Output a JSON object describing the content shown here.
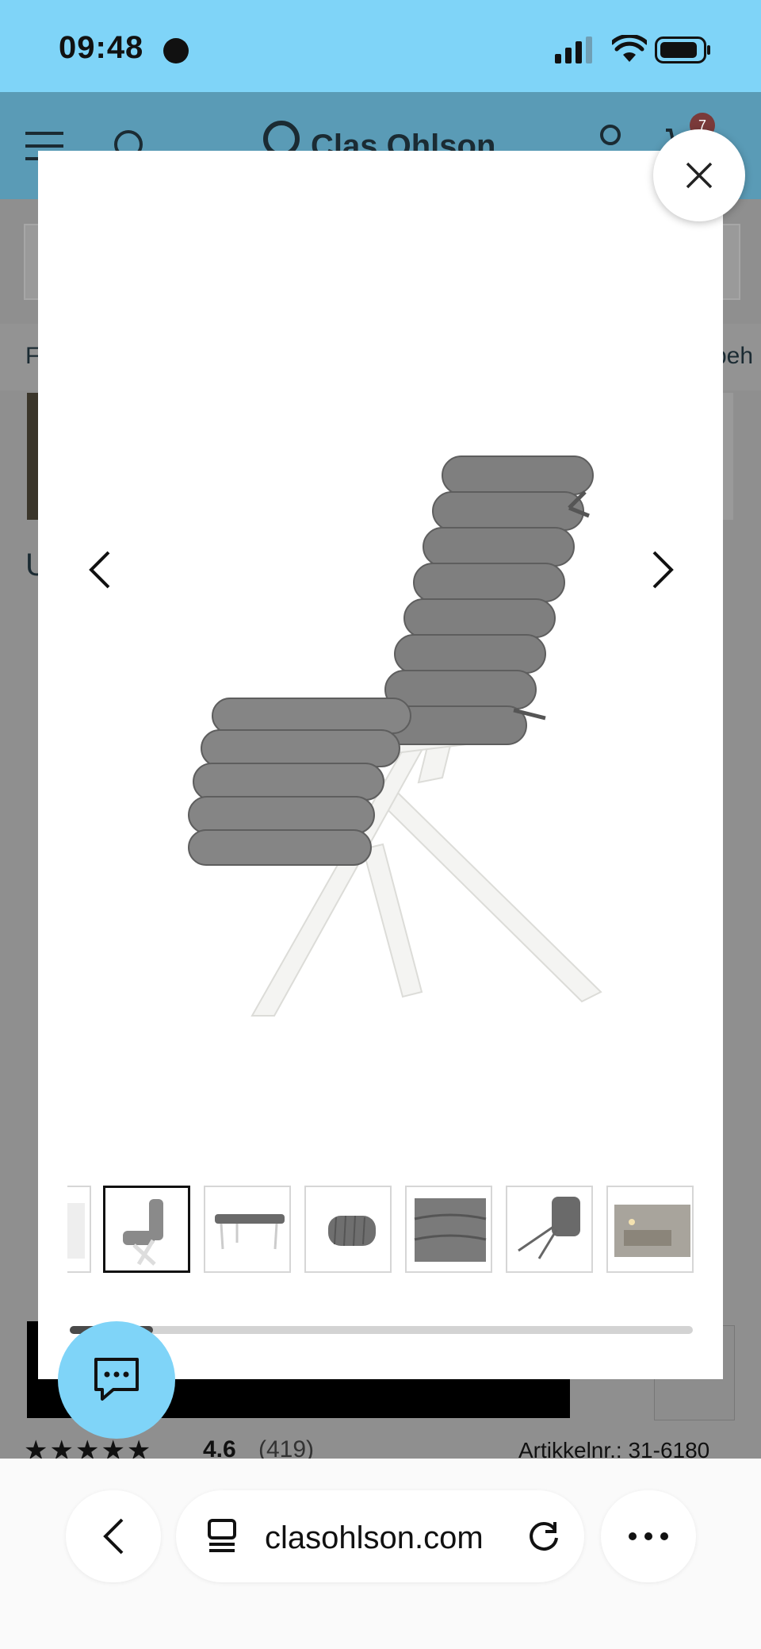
{
  "status_bar": {
    "time": "09:48"
  },
  "site_header": {
    "brand": "Clas Ohlson",
    "cart_count": "7"
  },
  "background_page": {
    "tab_left_partial": "F",
    "tab_right_partial": "beh",
    "title_partial": "U",
    "rating": "4.6",
    "reviews": "(419)",
    "article_number": "Artikkelnr.: 31-6180"
  },
  "modal": {
    "prev_icon": "chevron-left-icon",
    "next_icon": "chevron-right-icon",
    "close_icon": "close-icon",
    "thumbnails": [
      "chair-partial",
      "chair-with-cushion",
      "bench-with-cushion",
      "rolled-cushion",
      "cushion-detail",
      "cushion-ties",
      "lifestyle-scene"
    ],
    "active_thumbnail": 1,
    "scroll_position": 0.14
  },
  "chat_button": {
    "icon": "chat-icon"
  },
  "browser": {
    "url": "clasohlson.com",
    "back_icon": "back-icon",
    "tabs_icon": "tabs-icon",
    "reload_icon": "reload-icon",
    "more_icon": "more-icon"
  },
  "colors": {
    "accent": "#7fd4f8",
    "cushion": "#7f7f7f",
    "frame": "#f3f3f1"
  }
}
